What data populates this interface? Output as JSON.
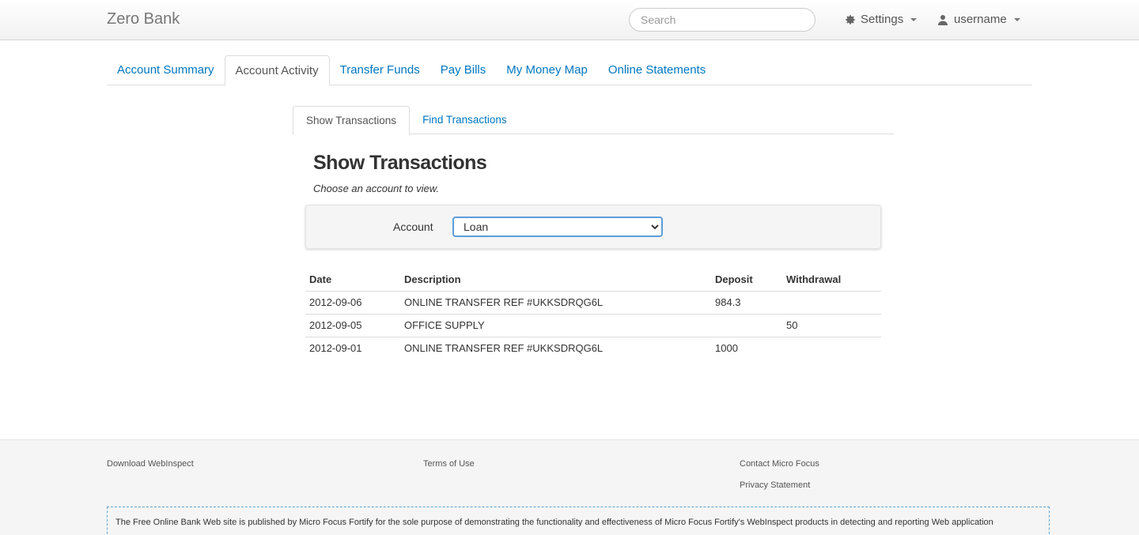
{
  "brand": "Zero Bank",
  "search": {
    "placeholder": "Search"
  },
  "settings_label": "Settings",
  "user_label": "username",
  "main_tabs": [
    {
      "label": "Account Summary"
    },
    {
      "label": "Account Activity",
      "active": true
    },
    {
      "label": "Transfer Funds"
    },
    {
      "label": "Pay Bills"
    },
    {
      "label": "My Money Map"
    },
    {
      "label": "Online Statements"
    }
  ],
  "sub_tabs": [
    {
      "label": "Show Transactions",
      "active": true
    },
    {
      "label": "Find Transactions"
    }
  ],
  "panel": {
    "title": "Show Transactions",
    "subtitle": "Choose an account to view.",
    "account_label": "Account",
    "account_selected": "Loan"
  },
  "table": {
    "headers": [
      "Date",
      "Description",
      "Deposit",
      "Withdrawal"
    ],
    "rows": [
      {
        "date": "2012-09-06",
        "description": "ONLINE TRANSFER REF #UKKSDRQG6L",
        "deposit": "984.3",
        "withdrawal": ""
      },
      {
        "date": "2012-09-05",
        "description": "OFFICE SUPPLY",
        "deposit": "",
        "withdrawal": "50"
      },
      {
        "date": "2012-09-01",
        "description": "ONLINE TRANSFER REF #UKKSDRQG6L",
        "deposit": "1000",
        "withdrawal": ""
      }
    ]
  },
  "footer": {
    "download": "Download WebInspect",
    "terms": "Terms of Use",
    "contact": "Contact Micro Focus",
    "privacy": "Privacy Statement",
    "disclaimer": "The Free Online Bank Web site is published by Micro Focus Fortify for the sole purpose of demonstrating the functionality and effectiveness of Micro Focus Fortify's WebInspect products in detecting and reporting Web application"
  },
  "colors": {
    "link": "#0077c0",
    "focus_border": "#5b9dd9",
    "dashed_border": "#5ba4d4"
  }
}
